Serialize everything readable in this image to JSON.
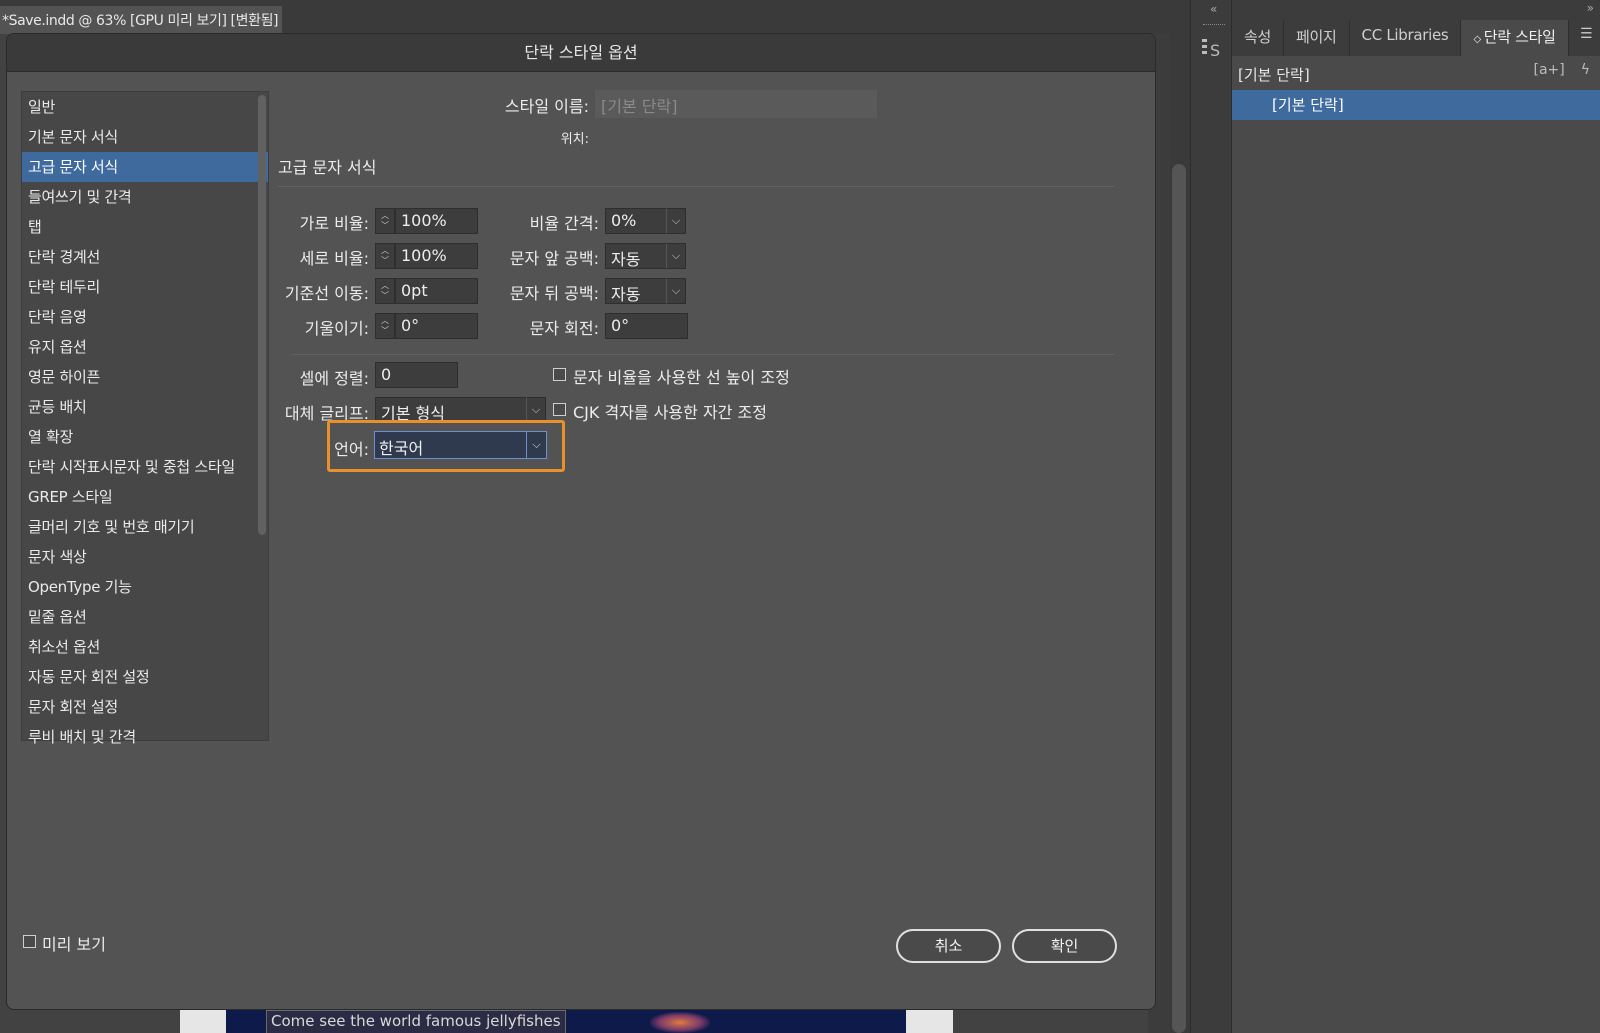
{
  "document": {
    "tab_title": "*Save.indd @ 63% [GPU 미리 보기] [변환됨]",
    "canvas_caption": "Come see the world famous jellyfishes"
  },
  "dialog": {
    "title": "단락 스타일 옵션",
    "style_name_label": "스타일 이름:",
    "style_name_value": "[기본 단락]",
    "location_label": "위치:",
    "section_title": "고급 문자 서식",
    "categories": [
      "일반",
      "기본 문자 서식",
      "고급 문자 서식",
      "들여쓰기 및 간격",
      "탭",
      "단락 경계선",
      "단락 테두리",
      "단락 음영",
      "유지 옵션",
      "영문 하이픈",
      "균등 배치",
      "열 확장",
      "단락 시작표시문자 및 중첩 스타일",
      "GREP 스타일",
      "글머리 기호 및 번호 매기기",
      "문자 색상",
      "OpenType 기능",
      "밑줄 옵션",
      "취소선 옵션",
      "자동 문자 회전 설정",
      "문자 회전 설정",
      "루비 배치 및 간격"
    ],
    "selected_category": "고급 문자 서식",
    "fields": {
      "horizontal_scale": {
        "label": "가로 비율:",
        "value": "100%"
      },
      "vertical_scale": {
        "label": "세로 비율:",
        "value": "100%"
      },
      "baseline_shift": {
        "label": "기준선 이동:",
        "value": "0pt"
      },
      "skew": {
        "label": "기울이기:",
        "value": "0°"
      },
      "tsume": {
        "label": "비율 간격:",
        "value": "0%"
      },
      "space_before": {
        "label": "문자 앞 공백:",
        "value": "자동"
      },
      "space_after": {
        "label": "문자 뒤 공백:",
        "value": "자동"
      },
      "char_rotation": {
        "label": "문자 회전:",
        "value": "0°"
      },
      "cell_align": {
        "label": "셀에 정렬:",
        "value": "0"
      },
      "alt_glyph": {
        "label": "대체 글리프:",
        "value": "기본 형식"
      },
      "language": {
        "label": "언어:",
        "value": "한국어"
      }
    },
    "checkboxes": {
      "scale_line_height": {
        "label": "문자 비율을 사용한 선 높이 조정",
        "checked": false
      },
      "cjk_grid": {
        "label": "CJK 격자를 사용한 자간 조정",
        "checked": false
      }
    },
    "preview_label": "미리 보기",
    "cancel_label": "취소",
    "ok_label": "확인",
    "highlight_color": "#e8902c"
  },
  "panel": {
    "tabs": [
      "속성",
      "페이지",
      "CC Libraries",
      "단락 스타일"
    ],
    "active_tab": "단락 스타일",
    "header": "[기본 단락]",
    "header_icon_new": "[a+]",
    "items": [
      "[기본 단락]"
    ]
  }
}
